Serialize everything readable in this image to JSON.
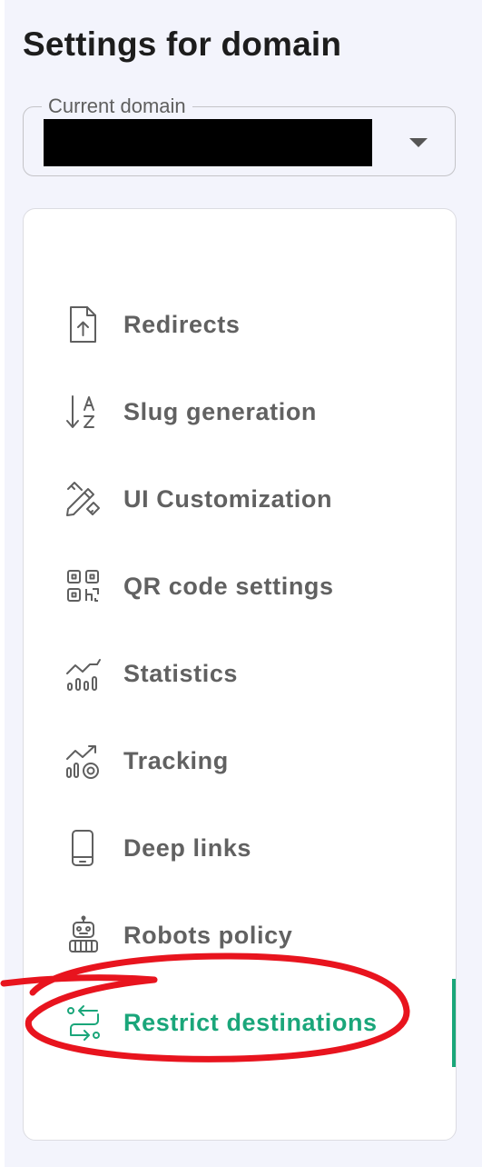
{
  "page": {
    "title": "Settings for domain"
  },
  "domain_select": {
    "label": "Current domain",
    "value": ""
  },
  "nav": {
    "items": [
      {
        "label": "Redirects",
        "icon": "file-upload-icon"
      },
      {
        "label": "Slug generation",
        "icon": "sort-az-icon"
      },
      {
        "label": "UI Customization",
        "icon": "ruler-pencil-icon"
      },
      {
        "label": "QR code settings",
        "icon": "qr-code-icon"
      },
      {
        "label": "Statistics",
        "icon": "stats-chart-icon"
      },
      {
        "label": "Tracking",
        "icon": "tracking-chart-icon"
      },
      {
        "label": "Deep links",
        "icon": "phone-icon"
      },
      {
        "label": "Robots policy",
        "icon": "robot-icon"
      },
      {
        "label": "Restrict destinations",
        "icon": "route-arrows-icon",
        "active": true
      }
    ]
  },
  "colors": {
    "accent": "#1aa67a",
    "text_muted": "#616161",
    "background": "#f3f4fc",
    "annotation": "#e8141e"
  }
}
